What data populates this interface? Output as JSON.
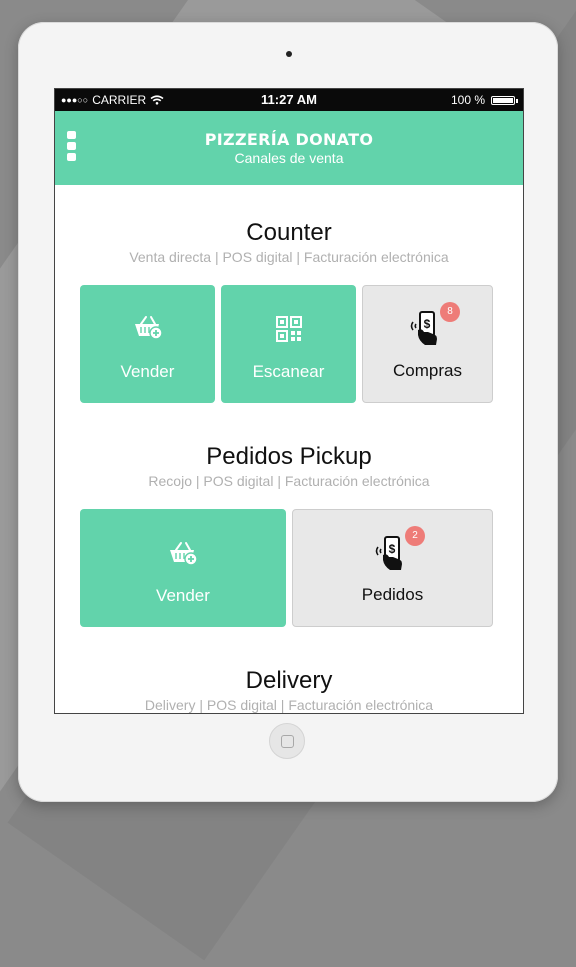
{
  "statusbar": {
    "carrier": "CARRIER",
    "time": "11:27 AM",
    "battery": "100 %"
  },
  "header": {
    "title": "PIZZERÍA DONATO",
    "subtitle": "Canales de venta"
  },
  "sections": [
    {
      "title": "Counter",
      "subtitle": "Venta directa | POS digital | Facturación electrónica",
      "tiles": [
        {
          "label": "Vender",
          "icon": "basket-add-icon"
        },
        {
          "label": "Escanear",
          "icon": "qr-code-icon"
        },
        {
          "label": "Compras",
          "icon": "phone-payment-icon",
          "badge": "8"
        }
      ]
    },
    {
      "title": "Pedidos Pickup",
      "subtitle": "Recojo | POS digital | Facturación electrónica",
      "tiles": [
        {
          "label": "Vender",
          "icon": "basket-add-icon"
        },
        {
          "label": "Pedidos",
          "icon": "phone-payment-icon",
          "badge": "2"
        }
      ]
    },
    {
      "title": "Delivery",
      "subtitle": "Delivery | POS digital | Facturación electrónica"
    }
  ],
  "colors": {
    "accent": "#62d3ab",
    "badge": "#ee7c78",
    "tile_grey": "#e8e8e8"
  }
}
